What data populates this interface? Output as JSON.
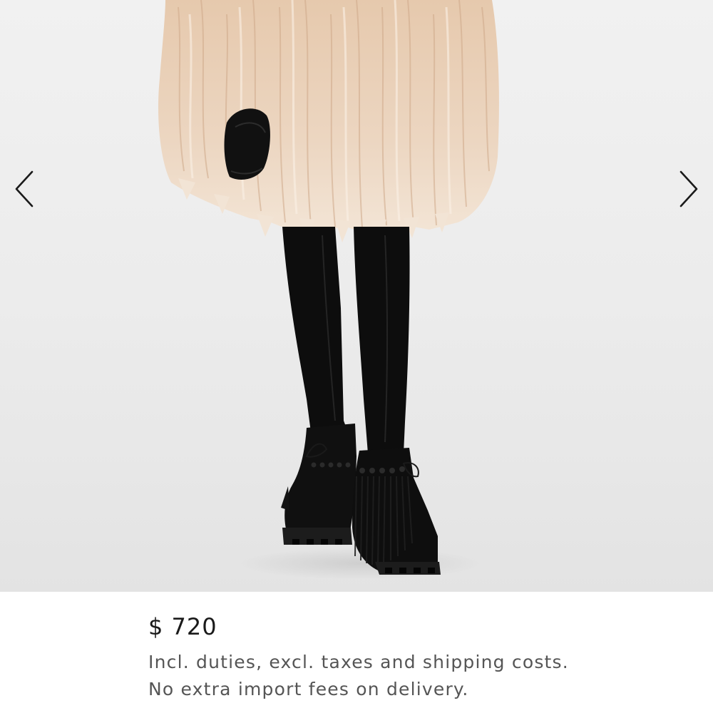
{
  "product": {
    "image": {
      "icon_prev": "chevron-left-icon",
      "icon_next": "chevron-right-icon",
      "background_color": "#ececec",
      "coat_color": "#e8cdb3",
      "garment_color": "#0d0d0d"
    },
    "price": "$ 720",
    "price_note_line1": "Incl. duties, excl. taxes and shipping costs.",
    "price_note_line2": "No extra import fees on delivery."
  }
}
